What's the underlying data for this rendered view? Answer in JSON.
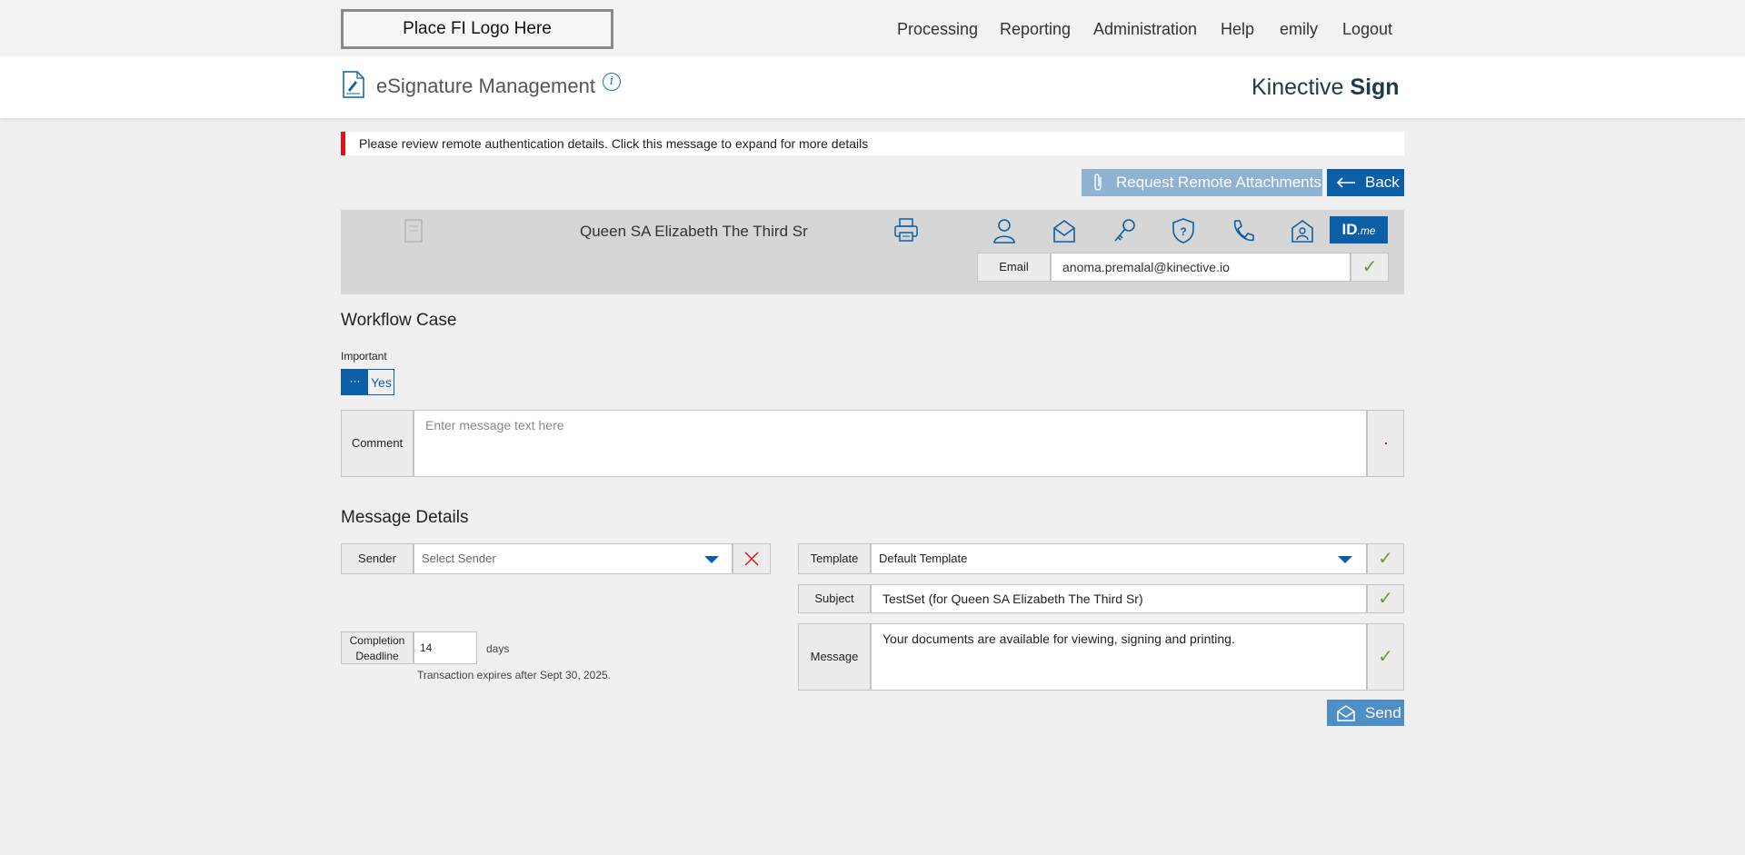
{
  "topbar": {
    "logo_placeholder": "Place FI Logo Here",
    "nav": [
      "Processing",
      "Reporting",
      "Administration",
      "Help",
      "emily",
      "Logout"
    ]
  },
  "header": {
    "title": "eSignature Management",
    "brand_light": "Kinective ",
    "brand_bold": "Sign"
  },
  "alert": {
    "text": "Please review remote authentication details. Click this message to expand for more details",
    "color": "#e3111a"
  },
  "actions": {
    "request_attachments": "Request Remote Attachments",
    "back": "Back"
  },
  "signer": {
    "name": "Queen SA Elizabeth The Third Sr",
    "auth_icons": [
      "person-icon",
      "envelope-icon",
      "key-icon",
      "shield-question-icon",
      "phone-icon",
      "id-card-icon"
    ],
    "idme_label": "ID",
    "idme_suffix": ".me",
    "email_label": "Email",
    "email_value": "anoma.premalal@kinective.io"
  },
  "workflow": {
    "title": "Workflow Case",
    "important_label": "Important",
    "important_value": "Yes",
    "comment_label": "Comment",
    "comment_placeholder": "Enter message text here"
  },
  "message": {
    "title": "Message Details",
    "sender_label": "Sender",
    "sender_placeholder": "Select Sender",
    "deadline_label_1": "Completion",
    "deadline_label_2": "Deadline",
    "deadline_value": "14",
    "days_label": "days",
    "expires_text": "Transaction expires after Sept 30, 2025.",
    "template_label": "Template",
    "template_value": "Default Template",
    "subject_label": "Subject",
    "subject_value": "TestSet (for Queen SA Elizabeth The Third Sr)",
    "message_label": "Message",
    "message_value": "Your documents are available for viewing, signing and printing.",
    "send": "Send"
  },
  "colors": {
    "primary": "#0c5fa6",
    "check": "#6e9a2a",
    "alert": "#e3111a"
  }
}
